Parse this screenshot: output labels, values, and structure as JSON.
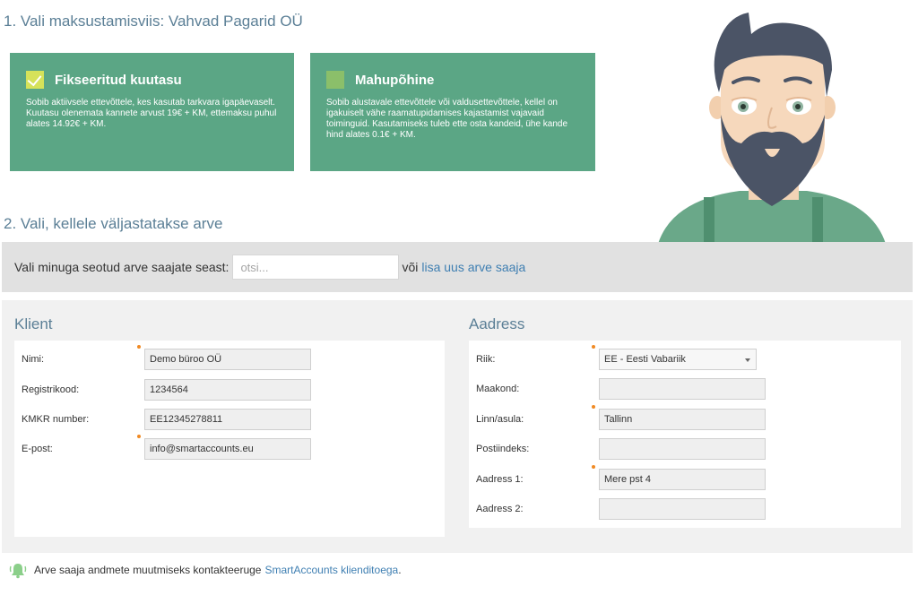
{
  "step1": {
    "title": "1. Vali maksustamisviis: Vahvad Pagarid OÜ",
    "plans": [
      {
        "title": "Fikseeritud kuutasu",
        "selected": true,
        "description": "Sobib aktiivsele ettevõttele, kes kasutab tarkvara igapäevaselt. Kuutasu olenemata kannete arvust 19€ + KM, ettemaksu puhul alates 14.92€ + KM."
      },
      {
        "title": "Mahupõhine",
        "selected": false,
        "description": "Sobib alustavale ettevõttele või valdusettevõttele, kellel on igakuiselt vähe raamatupidamises kajastamist vajavaid toiminguid. Kasutamiseks tuleb ette osta kandeid, ühe kande hind alates 0.1€ + KM."
      }
    ]
  },
  "step2": {
    "title": "2. Vali, kellele väljastatakse arve"
  },
  "search": {
    "label": "Vali minuga seotud arve saajate seast:",
    "placeholder": "otsi...",
    "or_text": "või",
    "add_link": "lisa uus arve saaja"
  },
  "klient": {
    "title": "Klient",
    "fields": [
      {
        "label": "Nimi:",
        "value": "Demo büroo OÜ",
        "required": true
      },
      {
        "label": "Registrikood:",
        "value": "1234564",
        "required": false
      },
      {
        "label": "KMKR number:",
        "value": "EE12345278811",
        "required": false
      },
      {
        "label": "E-post:",
        "value": "info@smartaccounts.eu",
        "required": true
      }
    ]
  },
  "aadress": {
    "title": "Aadress",
    "fields": [
      {
        "label": "Riik:",
        "value": "EE - Eesti Vabariik",
        "required": true,
        "type": "select"
      },
      {
        "label": "Maakond:",
        "value": "",
        "required": false
      },
      {
        "label": "Linn/asula:",
        "value": "Tallinn",
        "required": true
      },
      {
        "label": "Postiindeks:",
        "value": "",
        "required": false
      },
      {
        "label": "Aadress 1:",
        "value": "Mere pst 4",
        "required": true
      },
      {
        "label": "Aadress 2:",
        "value": "",
        "required": false
      }
    ]
  },
  "footer": {
    "text": "Arve saaja andmete muutmiseks kontakteeruge",
    "link": "SmartAccounts klienditoega",
    "suffix": "."
  },
  "icons": {
    "mascot": "bearded-man-illustration",
    "bell": "bell-icon",
    "check": "check-icon"
  },
  "colors": {
    "plan_green": "#5ba685",
    "checkbox_selected": "#d6e25a",
    "checkbox_unselected": "#8bbf6a",
    "title_blue": "#5b7f96",
    "link_blue": "#3f7fb2",
    "required_dot": "#f08a24"
  }
}
